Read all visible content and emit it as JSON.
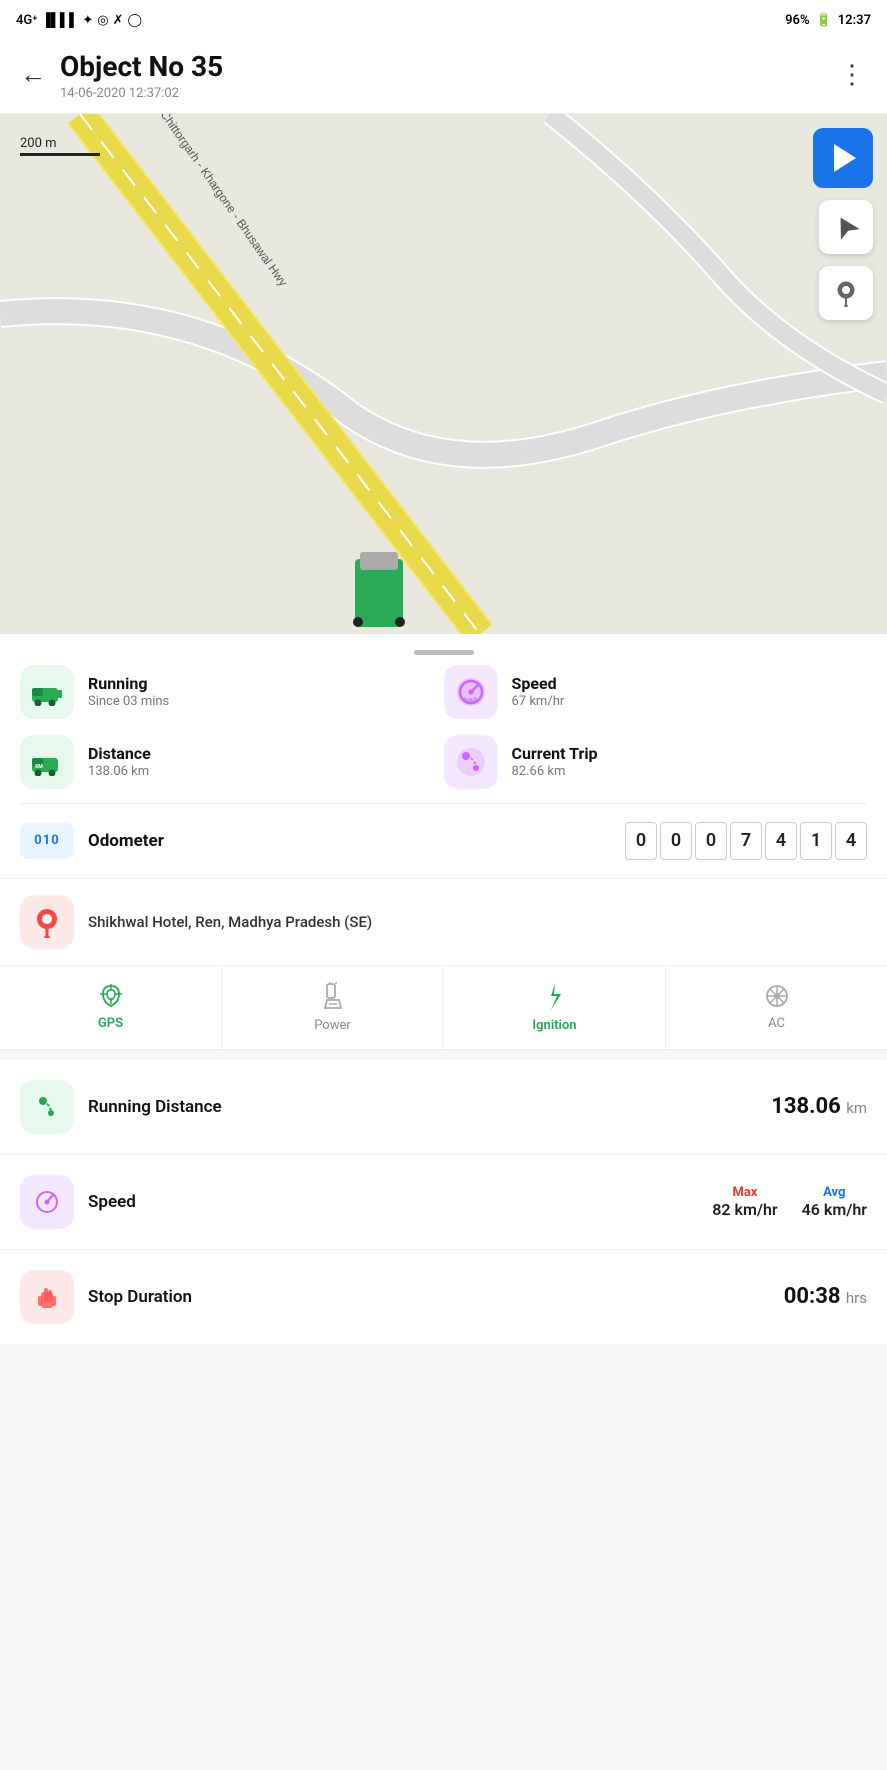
{
  "status_bar": {
    "signal": "4G",
    "battery": "96%",
    "time": "12:37"
  },
  "header": {
    "title": "Object No 35",
    "subtitle": "14-06-2020 12:37:02",
    "back_label": "←",
    "more_label": "⋮"
  },
  "map": {
    "scale_label": "200 m",
    "road_name": "Chittorgarh - Khargone - Bhusawal Hwy"
  },
  "drag_handle": "",
  "stats": {
    "running_label": "Running",
    "running_sub": "Since 03 mins",
    "speed_label": "Speed",
    "speed_sub": "67 km/hr",
    "distance_label": "Distance",
    "distance_sub": "138.06 km",
    "current_trip_label": "Current Trip",
    "current_trip_sub": "82.66 km"
  },
  "odometer": {
    "label": "Odometer",
    "icon_text": "010",
    "digits": [
      "0",
      "0",
      "0",
      "7",
      "4",
      "1",
      "4"
    ]
  },
  "location": {
    "text": "Shikhwal Hotel, Ren, Madhya Pradesh (SE)"
  },
  "sensors": [
    {
      "label": "GPS",
      "active": true,
      "color": "green"
    },
    {
      "label": "Power",
      "active": false,
      "color": "gray"
    },
    {
      "label": "Ignition",
      "active": true,
      "color": "green"
    },
    {
      "label": "AC",
      "active": false,
      "color": "gray"
    }
  ],
  "running_distance": {
    "label": "Running Distance",
    "value": "138.06",
    "unit": "km"
  },
  "speed_stats": {
    "label": "Speed",
    "max_label": "Max",
    "max_value": "82 km/hr",
    "avg_label": "Avg",
    "avg_value": "46 km/hr"
  },
  "stop_duration": {
    "label": "Stop Duration",
    "value": "00:38",
    "unit": "hrs"
  }
}
